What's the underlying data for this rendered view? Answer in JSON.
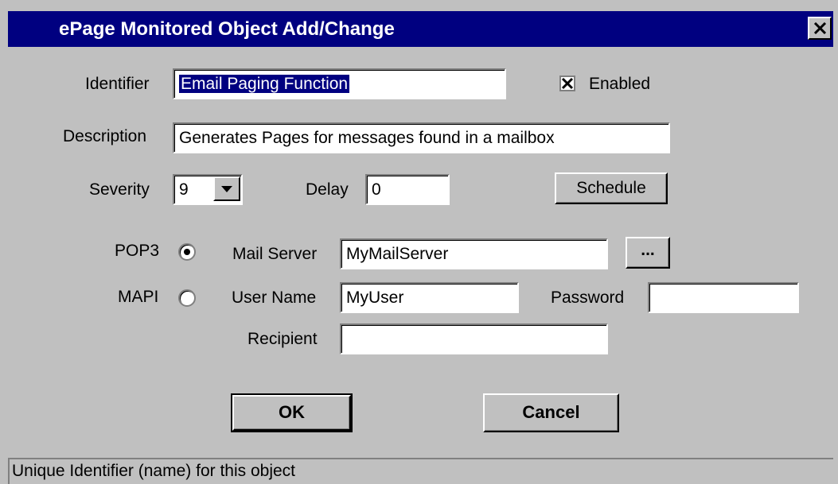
{
  "window": {
    "title": "ePage Monitored Object Add/Change"
  },
  "form": {
    "identifier_label": "Identifier",
    "identifier_value": "Email Paging Function",
    "enabled_label": "Enabled",
    "enabled_checked": true,
    "description_label": "Description",
    "description_value": "Generates Pages for messages found in a mailbox",
    "severity_label": "Severity",
    "severity_value": "9",
    "delay_label": "Delay",
    "delay_value": "0",
    "schedule_label": "Schedule",
    "pop3_label": "POP3",
    "mapi_label": "MAPI",
    "mail_protocol_selected": "POP3",
    "mail_server_label": "Mail Server",
    "mail_server_value": "MyMailServer",
    "browse_label": "...",
    "user_name_label": "User Name",
    "user_name_value": "MyUser",
    "password_label": "Password",
    "password_value": "",
    "recipient_label": "Recipient",
    "recipient_value": ""
  },
  "buttons": {
    "ok_label": "OK",
    "cancel_label": "Cancel"
  },
  "status": {
    "text": "Unique Identifier (name) for this object"
  },
  "icons": {
    "close": "close-icon",
    "dropdown": "chevron-down-icon",
    "checkbox": "checkmark-icon"
  },
  "colors": {
    "titlebar": "#000080",
    "face": "#c0c0c0",
    "selection": "#000080"
  }
}
